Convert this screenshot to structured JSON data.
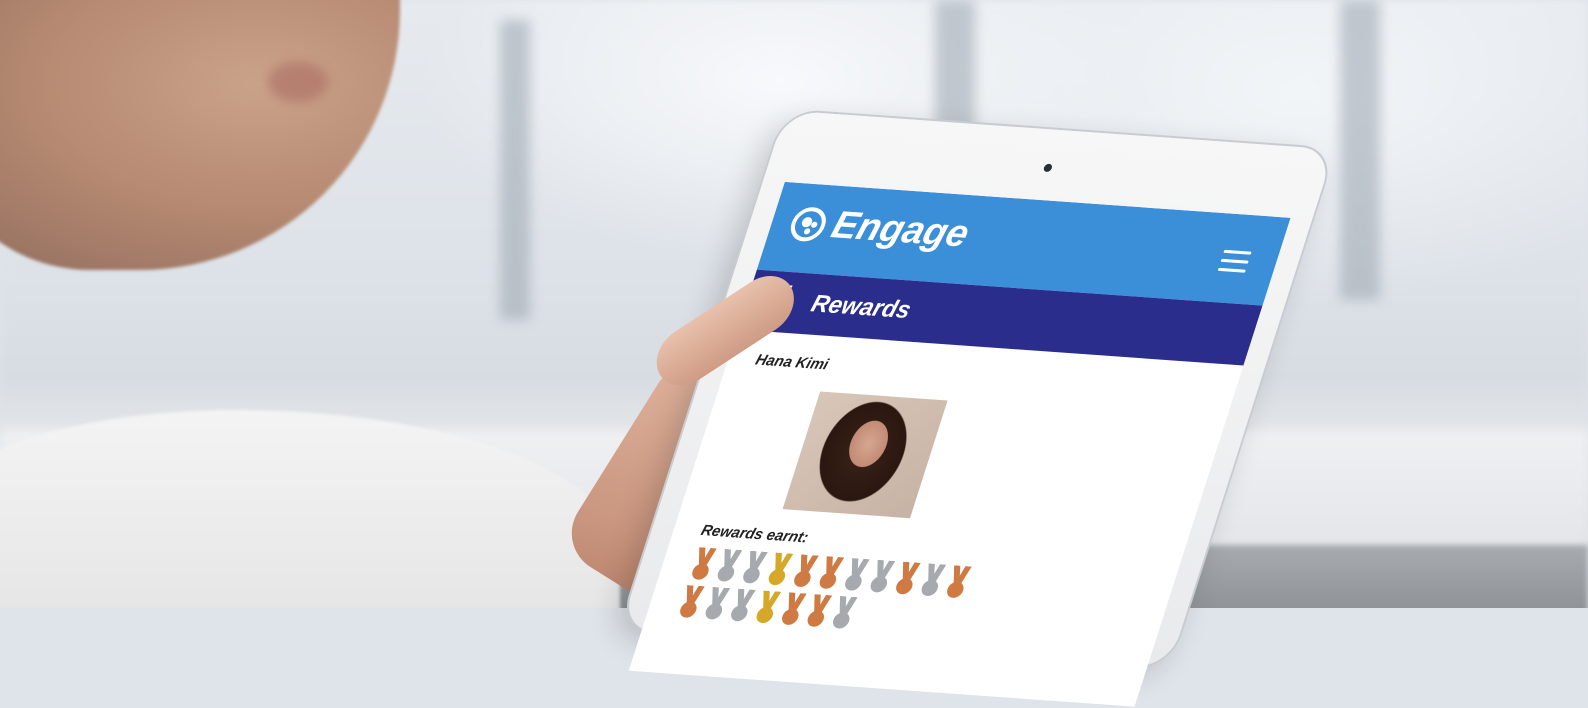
{
  "app": {
    "name": "Engage",
    "brand_color": "#3b8fd8",
    "section_color": "#2b2d8c"
  },
  "header": {
    "menu_icon": "hamburger-menu-icon"
  },
  "section": {
    "title": "Rewards",
    "icon": "medal-icon"
  },
  "profile": {
    "name": "Hana Kimi"
  },
  "rewards": {
    "label": "Rewards earnt:",
    "medals": [
      "bronze",
      "silver",
      "silver",
      "gold",
      "bronze",
      "bronze",
      "silver",
      "silver",
      "bronze",
      "silver",
      "bronze",
      "bronze",
      "silver",
      "silver",
      "gold",
      "bronze",
      "bronze",
      "silver"
    ],
    "colors": {
      "bronze": "#cf7a43",
      "silver": "#a6a9ad",
      "gold": "#d6a829"
    }
  }
}
